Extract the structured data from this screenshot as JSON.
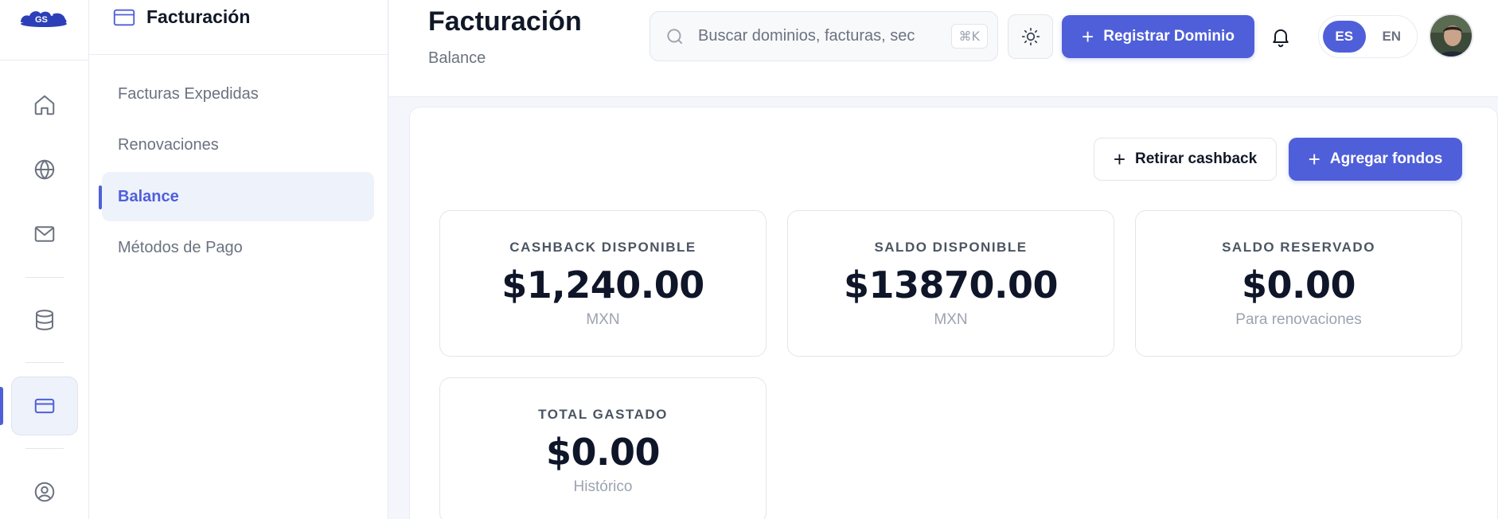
{
  "rail": {
    "items": [
      {
        "name": "home",
        "icon": "home-icon"
      },
      {
        "name": "domains",
        "icon": "globe-icon"
      },
      {
        "name": "email",
        "icon": "mail-icon"
      },
      {
        "name": "hosting",
        "icon": "database-icon"
      },
      {
        "name": "billing",
        "icon": "credit-card-icon",
        "active": true
      },
      {
        "name": "account",
        "icon": "user-circle-icon"
      }
    ]
  },
  "sidebar": {
    "section_title": "Facturación",
    "section_icon": "credit-card-icon",
    "items": [
      {
        "label": "Facturas Expedidas"
      },
      {
        "label": "Renovaciones"
      },
      {
        "label": "Balance",
        "active": true
      },
      {
        "label": "Métodos de Pago"
      }
    ]
  },
  "header": {
    "title": "Facturación",
    "subtitle": "Balance",
    "search": {
      "placeholder": "Buscar dominios, facturas, sec",
      "shortcut": "⌘K"
    },
    "theme_icon": "sun-icon",
    "register_label": "Registrar Dominio",
    "notifications_icon": "bell-icon",
    "languages": [
      {
        "code": "ES",
        "active": true
      },
      {
        "code": "EN",
        "active": false
      }
    ]
  },
  "actions": {
    "withdraw_label": "Retirar cashback",
    "add_funds_label": "Agregar fondos"
  },
  "stats": [
    {
      "label": "CASHBACK DISPONIBLE",
      "value": "$1,240.00",
      "unit": "MXN"
    },
    {
      "label": "SALDO DISPONIBLE",
      "value": "$13870.00",
      "unit": "MXN"
    },
    {
      "label": "SALDO RESERVADO",
      "value": "$0.00",
      "unit": "Para renovaciones"
    },
    {
      "label": "TOTAL GASTADO",
      "value": "$0.00",
      "unit": "Histórico"
    }
  ],
  "colors": {
    "accent": "#4f5fd9",
    "background": "#f4f6fb",
    "text": "#111827",
    "muted": "#6b7280"
  }
}
